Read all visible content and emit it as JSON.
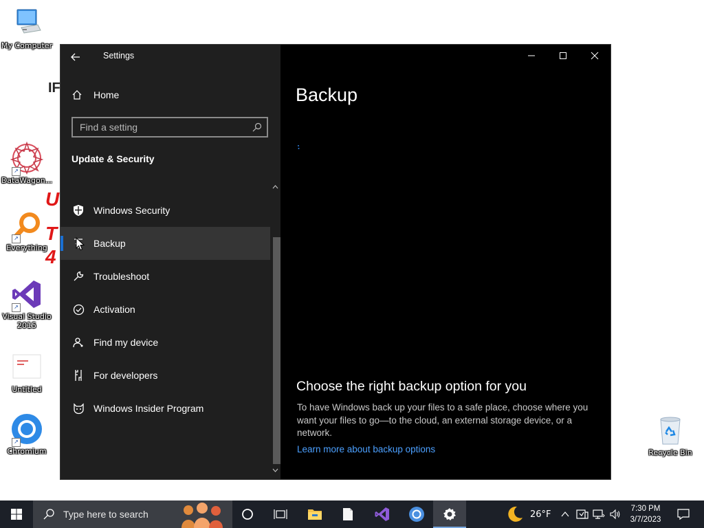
{
  "desktop": {
    "icons": [
      {
        "label": "My Computer"
      },
      {
        "label": "DataWagon..."
      },
      {
        "label": "Everything"
      },
      {
        "label": "Visual Studio 2015"
      },
      {
        "label": "Untitled"
      },
      {
        "label": "Chromium"
      },
      {
        "label": "Recycle Bin"
      }
    ],
    "background_fragments": [
      "IF",
      "U",
      "T",
      "4"
    ]
  },
  "settings": {
    "window_title": "Settings",
    "home_label": "Home",
    "search_placeholder": "Find a setting",
    "section_heading": "Update & Security",
    "nav_items": [
      {
        "label": "Windows Security",
        "icon": "shield-icon"
      },
      {
        "label": "Backup",
        "icon": "backup-icon",
        "selected": true
      },
      {
        "label": "Troubleshoot",
        "icon": "wrench-icon"
      },
      {
        "label": "Activation",
        "icon": "check-circle-icon"
      },
      {
        "label": "Find my device",
        "icon": "person-location-icon"
      },
      {
        "label": "For developers",
        "icon": "developer-tools-icon"
      },
      {
        "label": "Windows Insider Program",
        "icon": "insider-cat-icon"
      }
    ],
    "content": {
      "page_title": "Backup",
      "section_heading": "Choose the right backup option for you",
      "description": "To have Windows back up your files to a safe place, choose where you want your files to go—to the cloud, an external storage device, or a network.",
      "link": "Learn more about backup options"
    },
    "accent_color": "#1a6fd1",
    "link_color": "#4ca0ff"
  },
  "taskbar": {
    "search_placeholder": "Type here to search",
    "pinned": [
      "cortana-icon",
      "task-view-icon",
      "file-explorer-icon",
      "document-icon",
      "visual-studio-icon",
      "chromium-icon",
      "settings-gear-icon"
    ],
    "weather": {
      "temp": "26°F",
      "icon": "moon-icon"
    },
    "clock": {
      "time": "7:30 PM",
      "date": "3/7/2023"
    }
  }
}
